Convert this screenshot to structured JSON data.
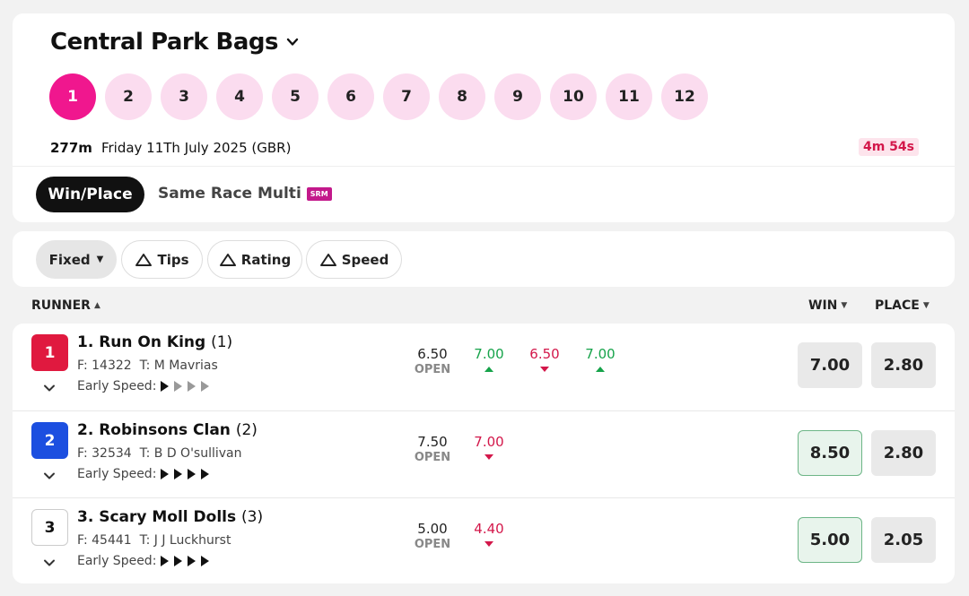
{
  "meeting": {
    "title": "Central Park Bags",
    "races": [
      "1",
      "2",
      "3",
      "4",
      "5",
      "6",
      "7",
      "8",
      "9",
      "10",
      "11",
      "12"
    ],
    "active_race": "1",
    "distance": "277m",
    "date": "Friday 11Th July 2025 (GBR)",
    "countdown": "4m 54s"
  },
  "tabs": {
    "win_place": "Win/Place",
    "srm": "Same Race Multi",
    "srm_badge": "SRM"
  },
  "filters": {
    "fixed": "Fixed",
    "tips": "Tips",
    "rating": "Rating",
    "speed": "Speed"
  },
  "columns": {
    "runner": "RUNNER",
    "win": "WIN",
    "place": "PLACE"
  },
  "runners": [
    {
      "name": "1. Run On King",
      "barrier": "(1)",
      "number": "1",
      "saddle_color": "#e0193f",
      "form": "F: 14322",
      "trainer": "T: M Mavrias",
      "early_speed_label": "Early Speed:",
      "early_speed": 1,
      "open": "6.50",
      "open_label": "OPEN",
      "flucs": [
        {
          "v": "7.00",
          "dir": "up"
        },
        {
          "v": "6.50",
          "dir": "down"
        },
        {
          "v": "7.00",
          "dir": "up"
        }
      ],
      "win": "7.00",
      "place": "2.80",
      "win_highlight": false
    },
    {
      "name": "2. Robinsons Clan",
      "barrier": "(2)",
      "number": "2",
      "saddle_color": "#1c4fe0",
      "form": "F: 32534",
      "trainer": "T: B D O'sullivan",
      "early_speed_label": "Early Speed:",
      "early_speed": 4,
      "open": "7.50",
      "open_label": "OPEN",
      "flucs": [
        {
          "v": "7.00",
          "dir": "down"
        }
      ],
      "win": "8.50",
      "place": "2.80",
      "win_highlight": true
    },
    {
      "name": "3. Scary Moll Dolls",
      "barrier": "(3)",
      "number": "3",
      "saddle_color": "#ffffff",
      "form": "F: 45441",
      "trainer": "T: J J Luckhurst",
      "early_speed_label": "Early Speed:",
      "early_speed": 4,
      "open": "5.00",
      "open_label": "OPEN",
      "flucs": [
        {
          "v": "4.40",
          "dir": "down"
        }
      ],
      "win": "5.00",
      "place": "2.05",
      "win_highlight": true
    }
  ]
}
